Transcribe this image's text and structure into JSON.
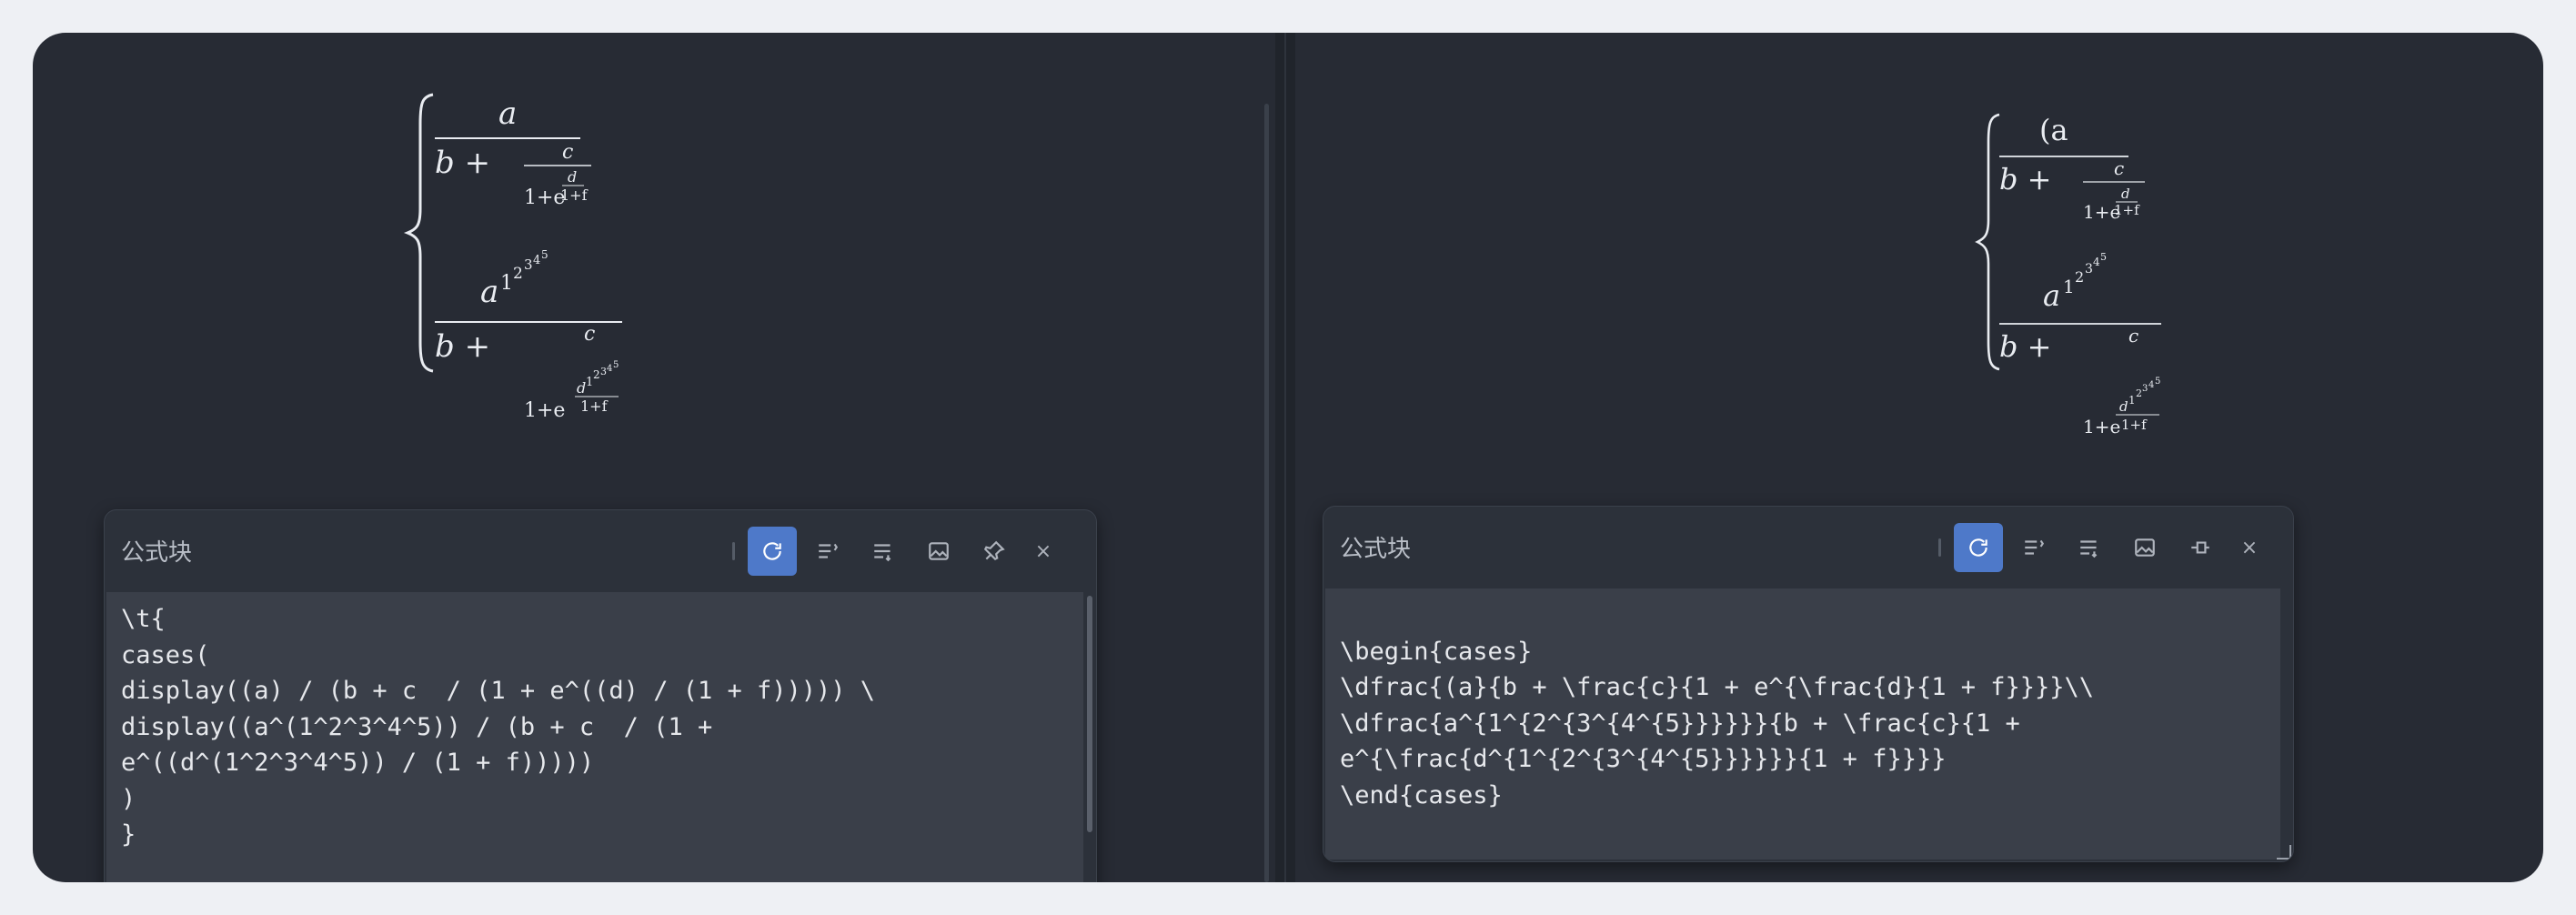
{
  "left_pane": {
    "panel": {
      "title": "公式块",
      "toolbar": {
        "refresh_icon": "refresh-icon",
        "align_icon": "list-indent-icon",
        "wrap_icon": "list-wrap-icon",
        "image_icon": "image-icon",
        "pin_icon": "pin-icon",
        "close_label": "×"
      },
      "code": "\\t{\ncases(\ndisplay((a) / (b + c  / (1 + e^((d) / (1 + f))))) \\\ndisplay((a^(1^2^3^4^5)) / (b + c  / (1 + \ne^((d^(1^2^3^4^5)) / (1 + f)))))\n)\n}"
    }
  },
  "right_pane": {
    "panel": {
      "title": "公式块",
      "toolbar": {
        "refresh_icon": "refresh-icon",
        "align_icon": "list-indent-icon",
        "wrap_icon": "list-wrap-icon",
        "image_icon": "image-icon",
        "pin_icon": "pin-outline-icon",
        "close_label": "×"
      },
      "code": "\n\\begin{cases}\n\\dfrac{(a}{b + \\frac{c}{1 + e^{\\frac{d}{1 + f}}}}\\\\\n\\dfrac{a^{1^{2^{3^{4^{5}}}}}}{b + \\frac{c}{1 + \ne^{\\frac{d^{1^{2^{3^{4^{5}}}}}}{1 + f}}}}\n\\end{cases}"
    }
  },
  "math_glyphs": {
    "a": "a",
    "b_plus": "b +",
    "c": "c",
    "d": "d",
    "one_plus_e": "1+e",
    "one_plus_f": "1+f",
    "open_paren_a": "(a",
    "one": "1",
    "two": "2",
    "three": "3",
    "four": "4",
    "five": "5"
  },
  "colors": {
    "accent": "#4e79c9",
    "background": "#272b34",
    "code_bg": "#3a3f49"
  }
}
